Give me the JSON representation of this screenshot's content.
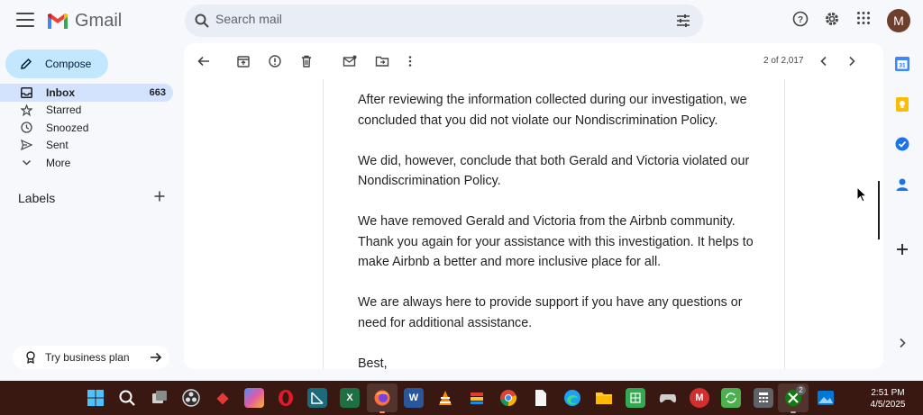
{
  "app": {
    "name": "Gmail"
  },
  "search": {
    "placeholder": "Search mail"
  },
  "user": {
    "avatar_initial": "M"
  },
  "compose": {
    "label": "Compose"
  },
  "nav": {
    "items": [
      {
        "label": "Inbox",
        "count": "663",
        "icon": "inbox-icon"
      },
      {
        "label": "Starred",
        "icon": "star-icon"
      },
      {
        "label": "Snoozed",
        "icon": "clock-icon"
      },
      {
        "label": "Sent",
        "icon": "send-icon"
      },
      {
        "label": "More",
        "icon": "chevron-down-icon"
      }
    ],
    "labels_title": "Labels"
  },
  "business": {
    "label": "Try business plan"
  },
  "toolbar": {
    "pager": "2 of 2,017"
  },
  "message": {
    "paragraphs": [
      "After reviewing the information collected during our investigation, we concluded that you did not violate our Nondiscrimination Policy.",
      "We did, however, conclude that both Gerald and Victoria violated our Nondiscrimination Policy.",
      "We have removed Gerald and Victoria from the Airbnb community. Thank you again for your assistance with this investigation. It helps to make Airbnb a better and more inclusive place for all.",
      "We are always here to provide support if you have any questions or need for additional assistance.",
      "Best,"
    ]
  },
  "taskbar": {
    "time": "2:51 PM",
    "date": "4/5/2025",
    "xbox_badge": "2"
  },
  "colors": {
    "compose_bg": "#c2e7ff",
    "active_nav_bg": "#d3e3fd",
    "taskbar_bg": "#3a1812",
    "gmail_red": "#ea4335"
  }
}
